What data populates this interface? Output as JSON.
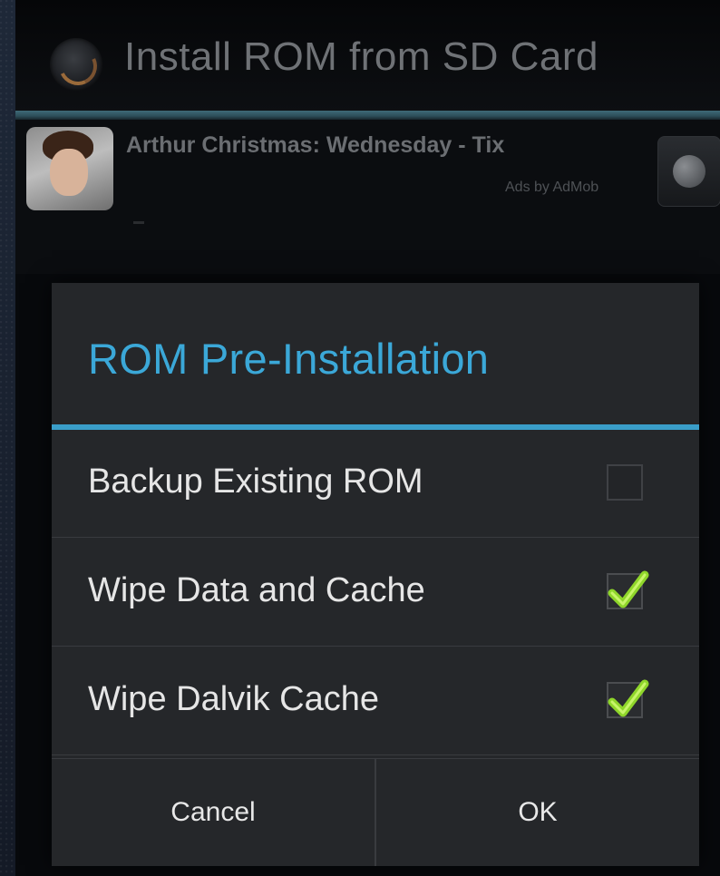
{
  "action_bar": {
    "title": "Install ROM from SD Card",
    "app_icon": "rom-manager-app-icon"
  },
  "ad": {
    "title": "Arthur Christmas: Wednesday - Tix",
    "provider": "Ads by AdMob",
    "thumbnail_icon": "ad-thumbnail-image",
    "action_icon": "globe-icon"
  },
  "dialog": {
    "title": "ROM Pre-Installation",
    "accent_color": "#3a9ec9",
    "options": [
      {
        "label": "Backup Existing ROM",
        "checked": false
      },
      {
        "label": "Wipe Data and Cache",
        "checked": true
      },
      {
        "label": "Wipe Dalvik Cache",
        "checked": true
      }
    ],
    "buttons": {
      "cancel": "Cancel",
      "ok": "OK"
    },
    "checkmark_color": "#8fd62a"
  }
}
